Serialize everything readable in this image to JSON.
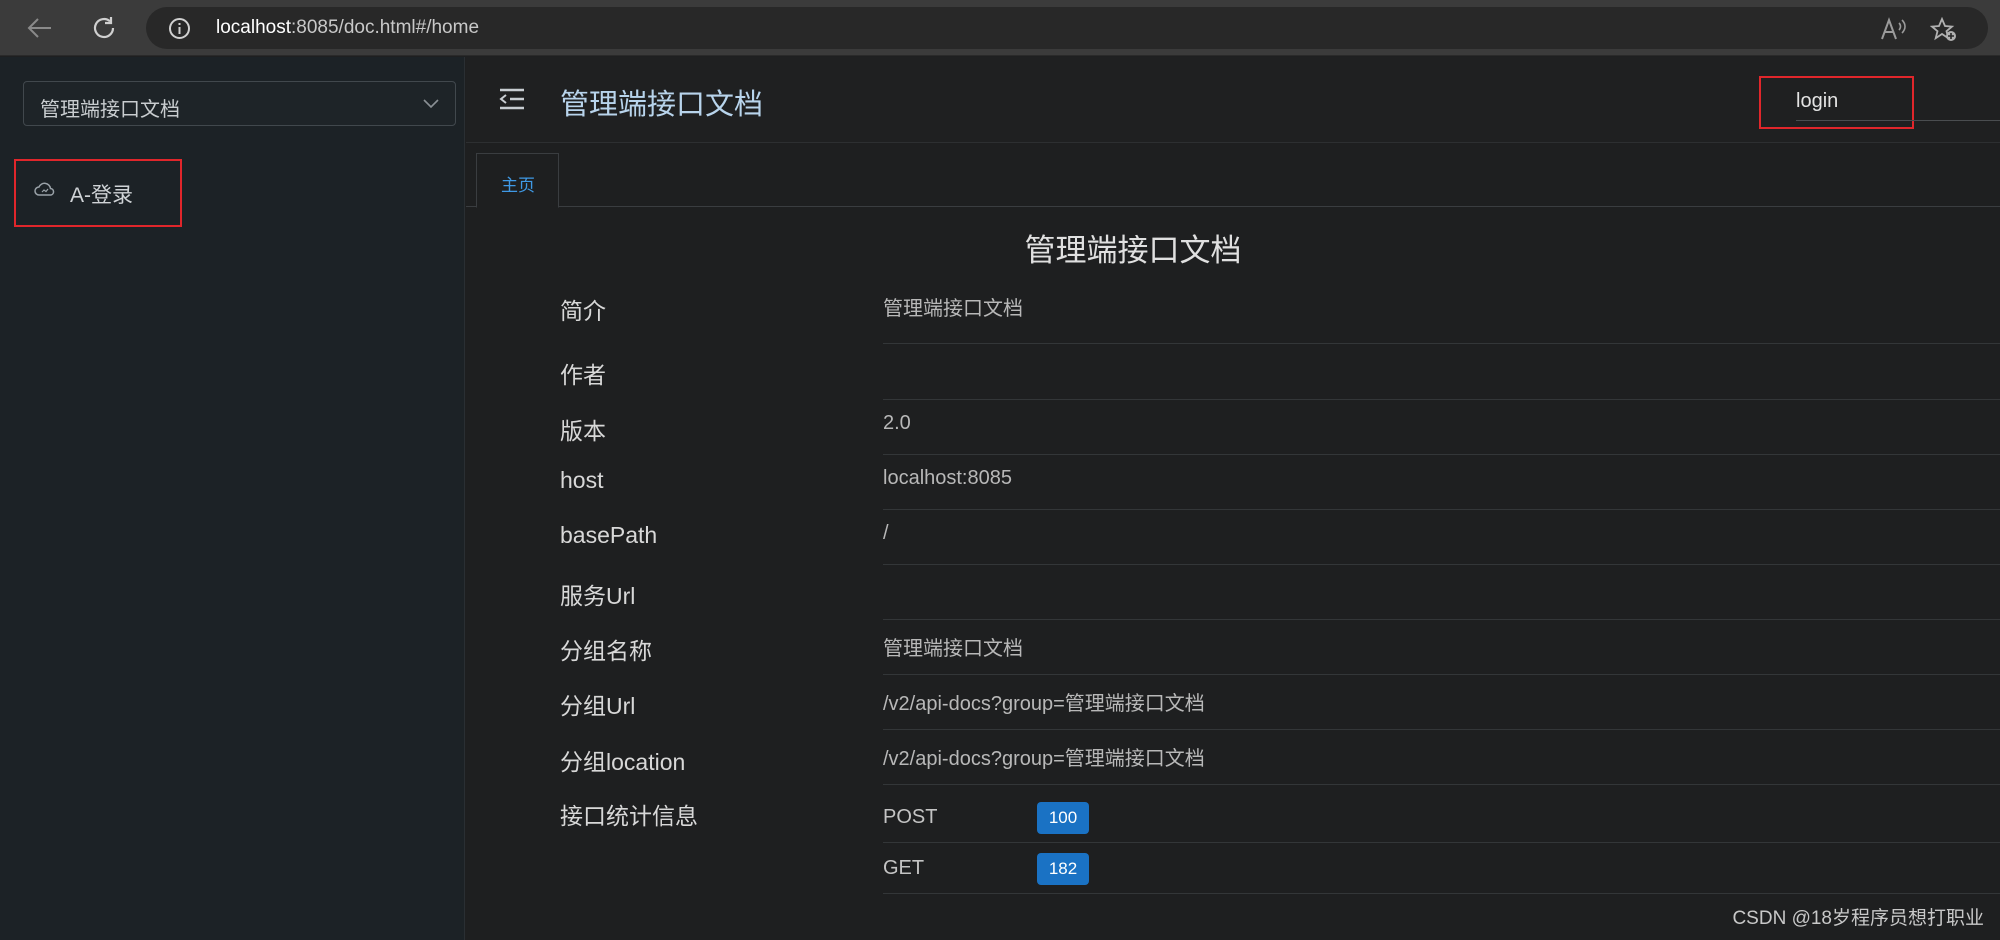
{
  "browser": {
    "url_host": "localhost",
    "url_rest": ":8085/doc.html#/home"
  },
  "sidebar": {
    "group_select": "管理端接口文档",
    "menu": [
      {
        "label": "A-登录"
      }
    ]
  },
  "header": {
    "title": "管理端接口文档",
    "search_value": "login"
  },
  "tabs": [
    {
      "label": "主页"
    }
  ],
  "doc": {
    "title": "管理端接口文档",
    "rows": [
      {
        "key": "简介",
        "value": "管理端接口文档"
      },
      {
        "key": "作者",
        "value": ""
      },
      {
        "key": "版本",
        "value": "2.0"
      },
      {
        "key": "host",
        "value": "localhost:8085"
      },
      {
        "key": "basePath",
        "value": "/"
      },
      {
        "key": "服务Url",
        "value": ""
      },
      {
        "key": "分组名称",
        "value": "管理端接口文档"
      },
      {
        "key": "分组Url",
        "value": "/v2/api-docs?group=管理端接口文档"
      },
      {
        "key": "分组location",
        "value": "/v2/api-docs?group=管理端接口文档"
      }
    ],
    "stats_label": "接口统计信息",
    "stats": [
      {
        "method": "POST",
        "count": "100"
      },
      {
        "method": "GET",
        "count": "182"
      }
    ]
  },
  "watermark": "CSDN @18岁程序员想打职业",
  "colors": {
    "accent": "#3f99e5",
    "badge": "#1a72c4",
    "highlight_box": "#e0262b"
  }
}
